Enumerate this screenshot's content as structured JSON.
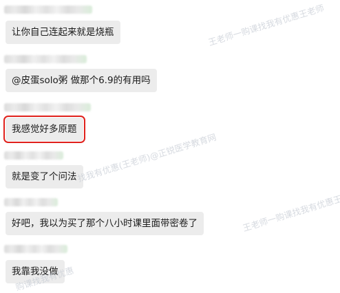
{
  "messages": [
    {
      "text": "让你自己连起来就是烧瓶",
      "highlighted": false
    },
    {
      "text": "@皮蛋solo粥 做那个6.9的有用吗",
      "highlighted": false
    },
    {
      "text": "我感觉好多原题",
      "highlighted": true
    },
    {
      "text": "就是变了个问法",
      "highlighted": false
    },
    {
      "text": "好吧，我以为买了那个八小时课里面带密卷了",
      "highlighted": false
    },
    {
      "text": "我靠我没做",
      "highlighted": false
    }
  ],
  "watermarks": [
    "王老师一购课找我有优惠王老师",
    "找我有优惠(王老师)@正锐医学教育网",
    "王老师一购课找我有优惠王老师",
    "购课找我有优惠"
  ],
  "colors": {
    "bubble": "#ececec",
    "highlight_border": "#e0201b",
    "watermark": "#c9ced6"
  }
}
